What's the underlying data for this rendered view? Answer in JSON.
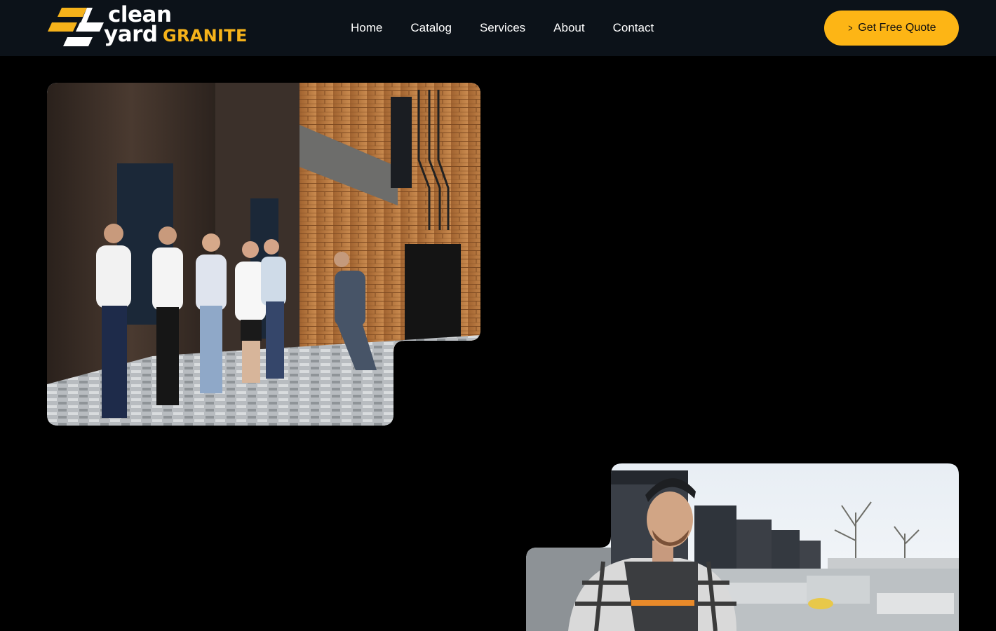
{
  "brand": {
    "logo_top": "clean",
    "logo_bottom": "yard",
    "logo_accent": "GRANITE",
    "accent_color": "#f5b21a"
  },
  "nav": {
    "items": [
      {
        "label": "Home"
      },
      {
        "label": "Catalog"
      },
      {
        "label": "Services"
      },
      {
        "label": "About"
      },
      {
        "label": "Contact"
      }
    ]
  },
  "cta": {
    "label": "Get Free Quote",
    "icon": "chevron-right-icon",
    "color": "#fdb515"
  },
  "photos": [
    {
      "name": "team-photo"
    },
    {
      "name": "worker-photo"
    }
  ]
}
